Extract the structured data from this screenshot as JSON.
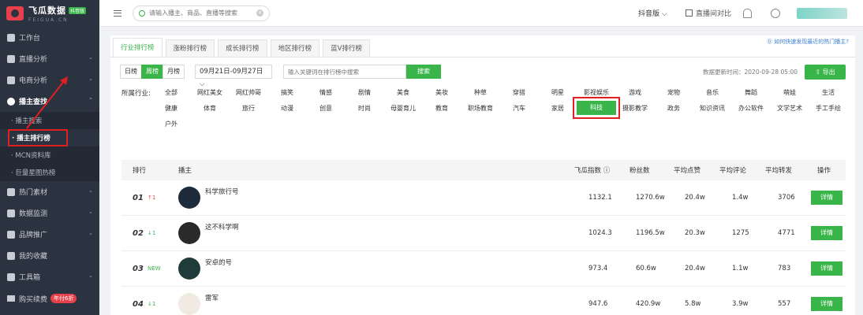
{
  "brand": {
    "name": "飞瓜数据",
    "badge": "抖音版",
    "sub": "FEIGUA.CN"
  },
  "sidebar": {
    "items": [
      {
        "label": "工作台"
      },
      {
        "label": "直播分析"
      },
      {
        "label": "电商分析"
      },
      {
        "label": "播主查找"
      }
    ],
    "subitems": [
      {
        "label": "· 播主搜索"
      },
      {
        "label": "· 播主排行榜"
      },
      {
        "label": "· MCN资料库"
      },
      {
        "label": "· 巨量星图热榜"
      }
    ],
    "lower_items": [
      {
        "label": "热门素材"
      },
      {
        "label": "数据监测"
      },
      {
        "label": "品牌推广"
      },
      {
        "label": "我的收藏"
      },
      {
        "label": "工具箱"
      }
    ],
    "buy": {
      "label": "购买续费",
      "tag": "年付6折"
    }
  },
  "topbar": {
    "search_placeholder": "请输入播主、商品、直播等搜索",
    "platform": "抖音版 ⌵",
    "compare": "直播间对比"
  },
  "tabs": [
    "行业排行榜",
    "涨粉排行榜",
    "成长排行榜",
    "地区排行榜",
    "蓝V排行榜"
  ],
  "help_link": "⓪ 如何快速发现最近的热门播主?",
  "filters": {
    "periods": [
      "日榜",
      "周榜",
      "月榜"
    ],
    "date": "09月21日-09月27日 ⌵",
    "keyword_placeholder": "输入关键词在排行榜中搜索",
    "search_label": "搜索",
    "updated": "数据更新时间：2020-09-28 05:00",
    "export_label": "⇧ 导出"
  },
  "industry": {
    "label": "所属行业:",
    "row1": [
      "全部",
      "网红美女",
      "网红帅哥",
      "搞笑",
      "情感",
      "剧情",
      "美食",
      "美妆",
      "种草",
      "穿搭",
      "明星",
      "影视娱乐",
      "游戏",
      "宠物",
      "音乐",
      "舞蹈",
      "萌娃",
      "生活"
    ],
    "row2": [
      "健康",
      "体育",
      "旅行",
      "动漫",
      "创意",
      "时尚",
      "母婴育儿",
      "教育",
      "职场教育",
      "汽车",
      "家居",
      "科技",
      "摄影教学",
      "政务",
      "知识资讯",
      "办公软件",
      "文学艺术",
      "手工手绘"
    ],
    "row3": [
      "户外"
    ]
  },
  "table": {
    "headers": {
      "rank": "排行",
      "streamer": "播主",
      "index": "飞瓜指数 ⓘ",
      "fans": "粉丝数",
      "likes": "平均点赞",
      "comments": "平均评论",
      "shares": "平均转发",
      "action": "操作"
    },
    "rows": [
      {
        "rank": "01",
        "trend": "↑1",
        "trend_type": "up",
        "name": "科学旅行号",
        "index": "1132.1",
        "fans": "1270.6w",
        "likes": "20.4w",
        "comments": "1.4w",
        "shares": "3706",
        "action": "详情"
      },
      {
        "rank": "02",
        "trend": "↓1",
        "trend_type": "down",
        "name": "这不科学啊",
        "index": "1024.3",
        "fans": "1196.5w",
        "likes": "20.3w",
        "comments": "1275",
        "shares": "4771",
        "action": "详情"
      },
      {
        "rank": "03",
        "trend": "NEW",
        "trend_type": "new",
        "name": "安卓的号",
        "index": "973.4",
        "fans": "60.6w",
        "likes": "20.4w",
        "comments": "1.1w",
        "shares": "783",
        "action": "详情"
      },
      {
        "rank": "04",
        "trend": "↓1",
        "trend_type": "down",
        "name": "雷军",
        "index": "947.6",
        "fans": "420.9w",
        "likes": "5.8w",
        "comments": "3.9w",
        "shares": "557",
        "action": "详情"
      }
    ]
  },
  "colors": {
    "accent": "#3ab54a",
    "sidebar": "#2b3240",
    "highlight": "#e02020"
  }
}
